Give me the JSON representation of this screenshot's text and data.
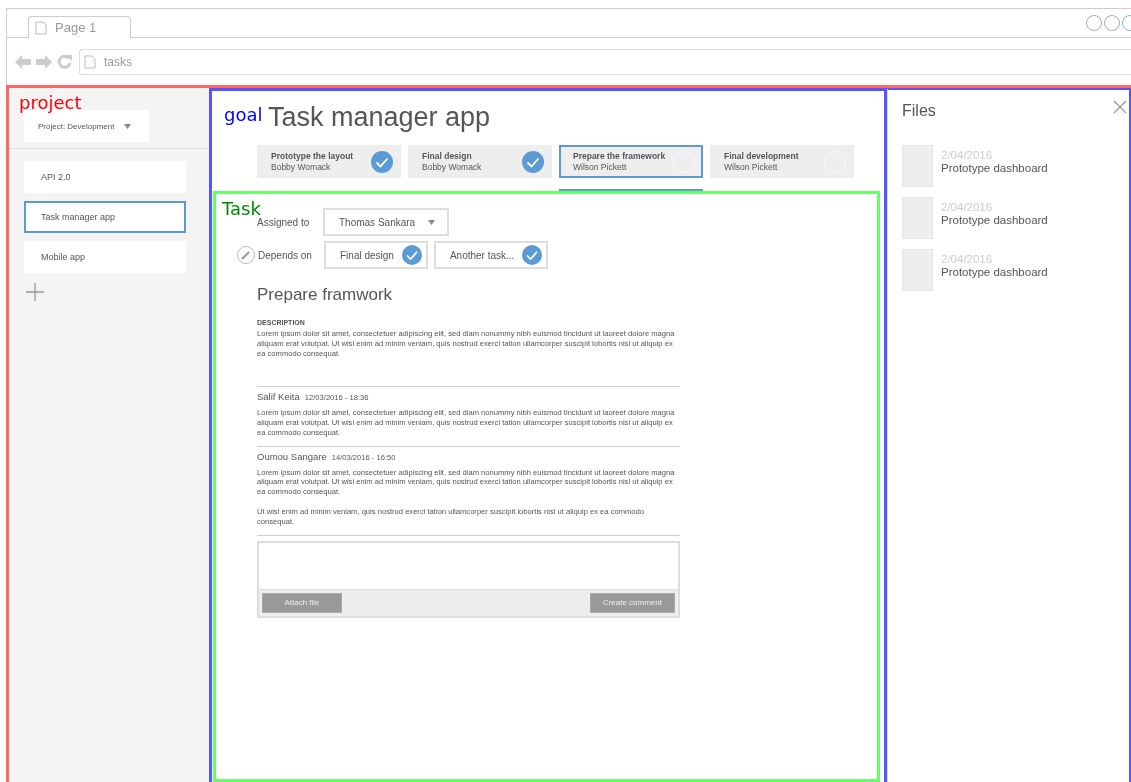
{
  "browser": {
    "tab": "Page 1",
    "address": "tasks"
  },
  "sidebar": {
    "annotation": "project",
    "project_select": "Project: Development",
    "items": [
      {
        "label": "API 2.0",
        "selected": false
      },
      {
        "label": "Task manager app",
        "selected": true
      },
      {
        "label": "Mobile app",
        "selected": false
      }
    ]
  },
  "goal": {
    "annotation": "goal",
    "title": "Task manager app",
    "steps": [
      {
        "title": "Prototype the layout",
        "person": "Bobby Womack",
        "done": true,
        "selected": false
      },
      {
        "title": "Final design",
        "person": "Bobby Womack",
        "done": true,
        "selected": false
      },
      {
        "title": "Prepare the framework",
        "person": "Wilson Pickett",
        "done": false,
        "selected": true
      },
      {
        "title": "Final development",
        "person": "Wilson Pickett",
        "done": false,
        "selected": false
      }
    ]
  },
  "task": {
    "annotation": "Task",
    "assigned_label": "Assigned to",
    "assignee": "Thomas Sankara",
    "depends_label": "Depends on",
    "depends": [
      {
        "label": "Final design",
        "done": true
      },
      {
        "label": "Another task...",
        "done": true
      }
    ],
    "title": "Prepare framwork",
    "description_label": "DESCRIPTION",
    "description": "Lorem ipsum dolor sit amet, consectetuer adipiscing elit, sed diam nonummy nibh euismod tincidunt ut laoreet dolore magna aliquam erat volutpat. Ut wisi enim ad minim veniam, quis nostrud exerci tation ullamcorper suscipit lobortis nisl ut aliquip ex ea commodo consequat.",
    "comments": [
      {
        "author": "Salif Keita",
        "time": "12/03/2016 - 18:36",
        "paragraphs": [
          "Lorem ipsum dolor sit amet, consectetuer adipiscing elit, sed diam nonummy nibh euismod tincidunt ut laoreet dolore magna aliquam erat volutpat. Ut wisi enim ad minim veniam, quis nostrud exerci tation ullamcorper suscipit lobortis nisl ut aliquip ex ea commodo consequat."
        ]
      },
      {
        "author": "Oumou Sangare",
        "time": "14/03/2016 - 16:50",
        "paragraphs": [
          "Lorem ipsum dolor sit amet, consectetuer adipiscing elit, sed diam nonummy nibh euismod tincidunt ut laoreet dolore magna aliquam erat volutpat. Ut wisi enim ad minim veniam, quis nostrud exerci tation ullamcorper suscipit lobortis nisl ut aliquip ex ea commodo consequat.",
          "Ut wisi enim ad minim veniam, quis nostrud exerci tation ullamcorper suscipit lobortis nisl ut aliquip ex ea commodo consequat."
        ]
      }
    ],
    "attach_button": "Attach file",
    "create_button": "Create comment"
  },
  "files": {
    "title": "Files",
    "items": [
      {
        "date": "2/04/2016",
        "name": "Prototype dashboard"
      },
      {
        "date": "2/04/2016",
        "name": "Prototype dashboard"
      },
      {
        "date": "2/04/2016",
        "name": "Prototype dashboard"
      }
    ]
  }
}
